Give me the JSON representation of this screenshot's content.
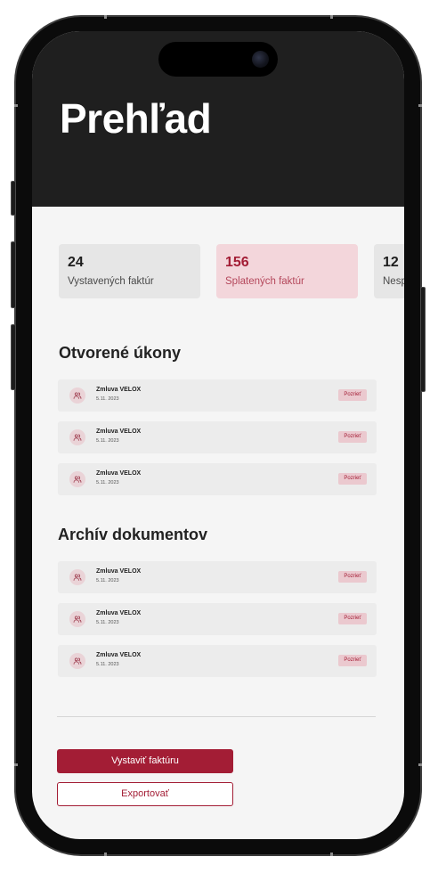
{
  "header": {
    "title": "Prehľad"
  },
  "stats": [
    {
      "value": "24",
      "label": "Vystavených faktúr"
    },
    {
      "value": "156",
      "label": "Splatených faktúr"
    },
    {
      "value": "12",
      "label": "Nesp"
    }
  ],
  "open_tasks": {
    "title": "Otvorené úkony",
    "items": [
      {
        "name": "Zmluva VELOX",
        "date": "5.11. 2023",
        "action": "Pozrieť",
        "icon": "users-icon"
      },
      {
        "name": "Zmluva VELOX",
        "date": "5.11. 2023",
        "action": "Pozrieť",
        "icon": "users-icon"
      },
      {
        "name": "Zmluva VELOX",
        "date": "5.11. 2023",
        "action": "Pozrieť",
        "icon": "users-icon"
      }
    ]
  },
  "archive": {
    "title": "Archív dokumentov",
    "items": [
      {
        "name": "Zmluva VELOX",
        "date": "5.11. 2023",
        "action": "Pozrieť",
        "icon": "users-icon"
      },
      {
        "name": "Zmluva VELOX",
        "date": "5.11. 2023",
        "action": "Pozrieť",
        "icon": "users-icon"
      },
      {
        "name": "Zmluva VELOX",
        "date": "5.11. 2023",
        "action": "Pozrieť",
        "icon": "users-icon"
      }
    ]
  },
  "actions": {
    "primary_label": "Vystaviť faktúru",
    "secondary_label": "Exportovať"
  },
  "colors": {
    "header_bg": "#1f1f1f",
    "accent": "#a31d35",
    "accent_soft": "#f3d6db",
    "page_bg": "#f5f5f5",
    "card_bg": "#e6e6e6",
    "row_bg": "#ececec",
    "badge_bg": "#ebc9cf",
    "avatar_bg": "#ead3d7"
  }
}
